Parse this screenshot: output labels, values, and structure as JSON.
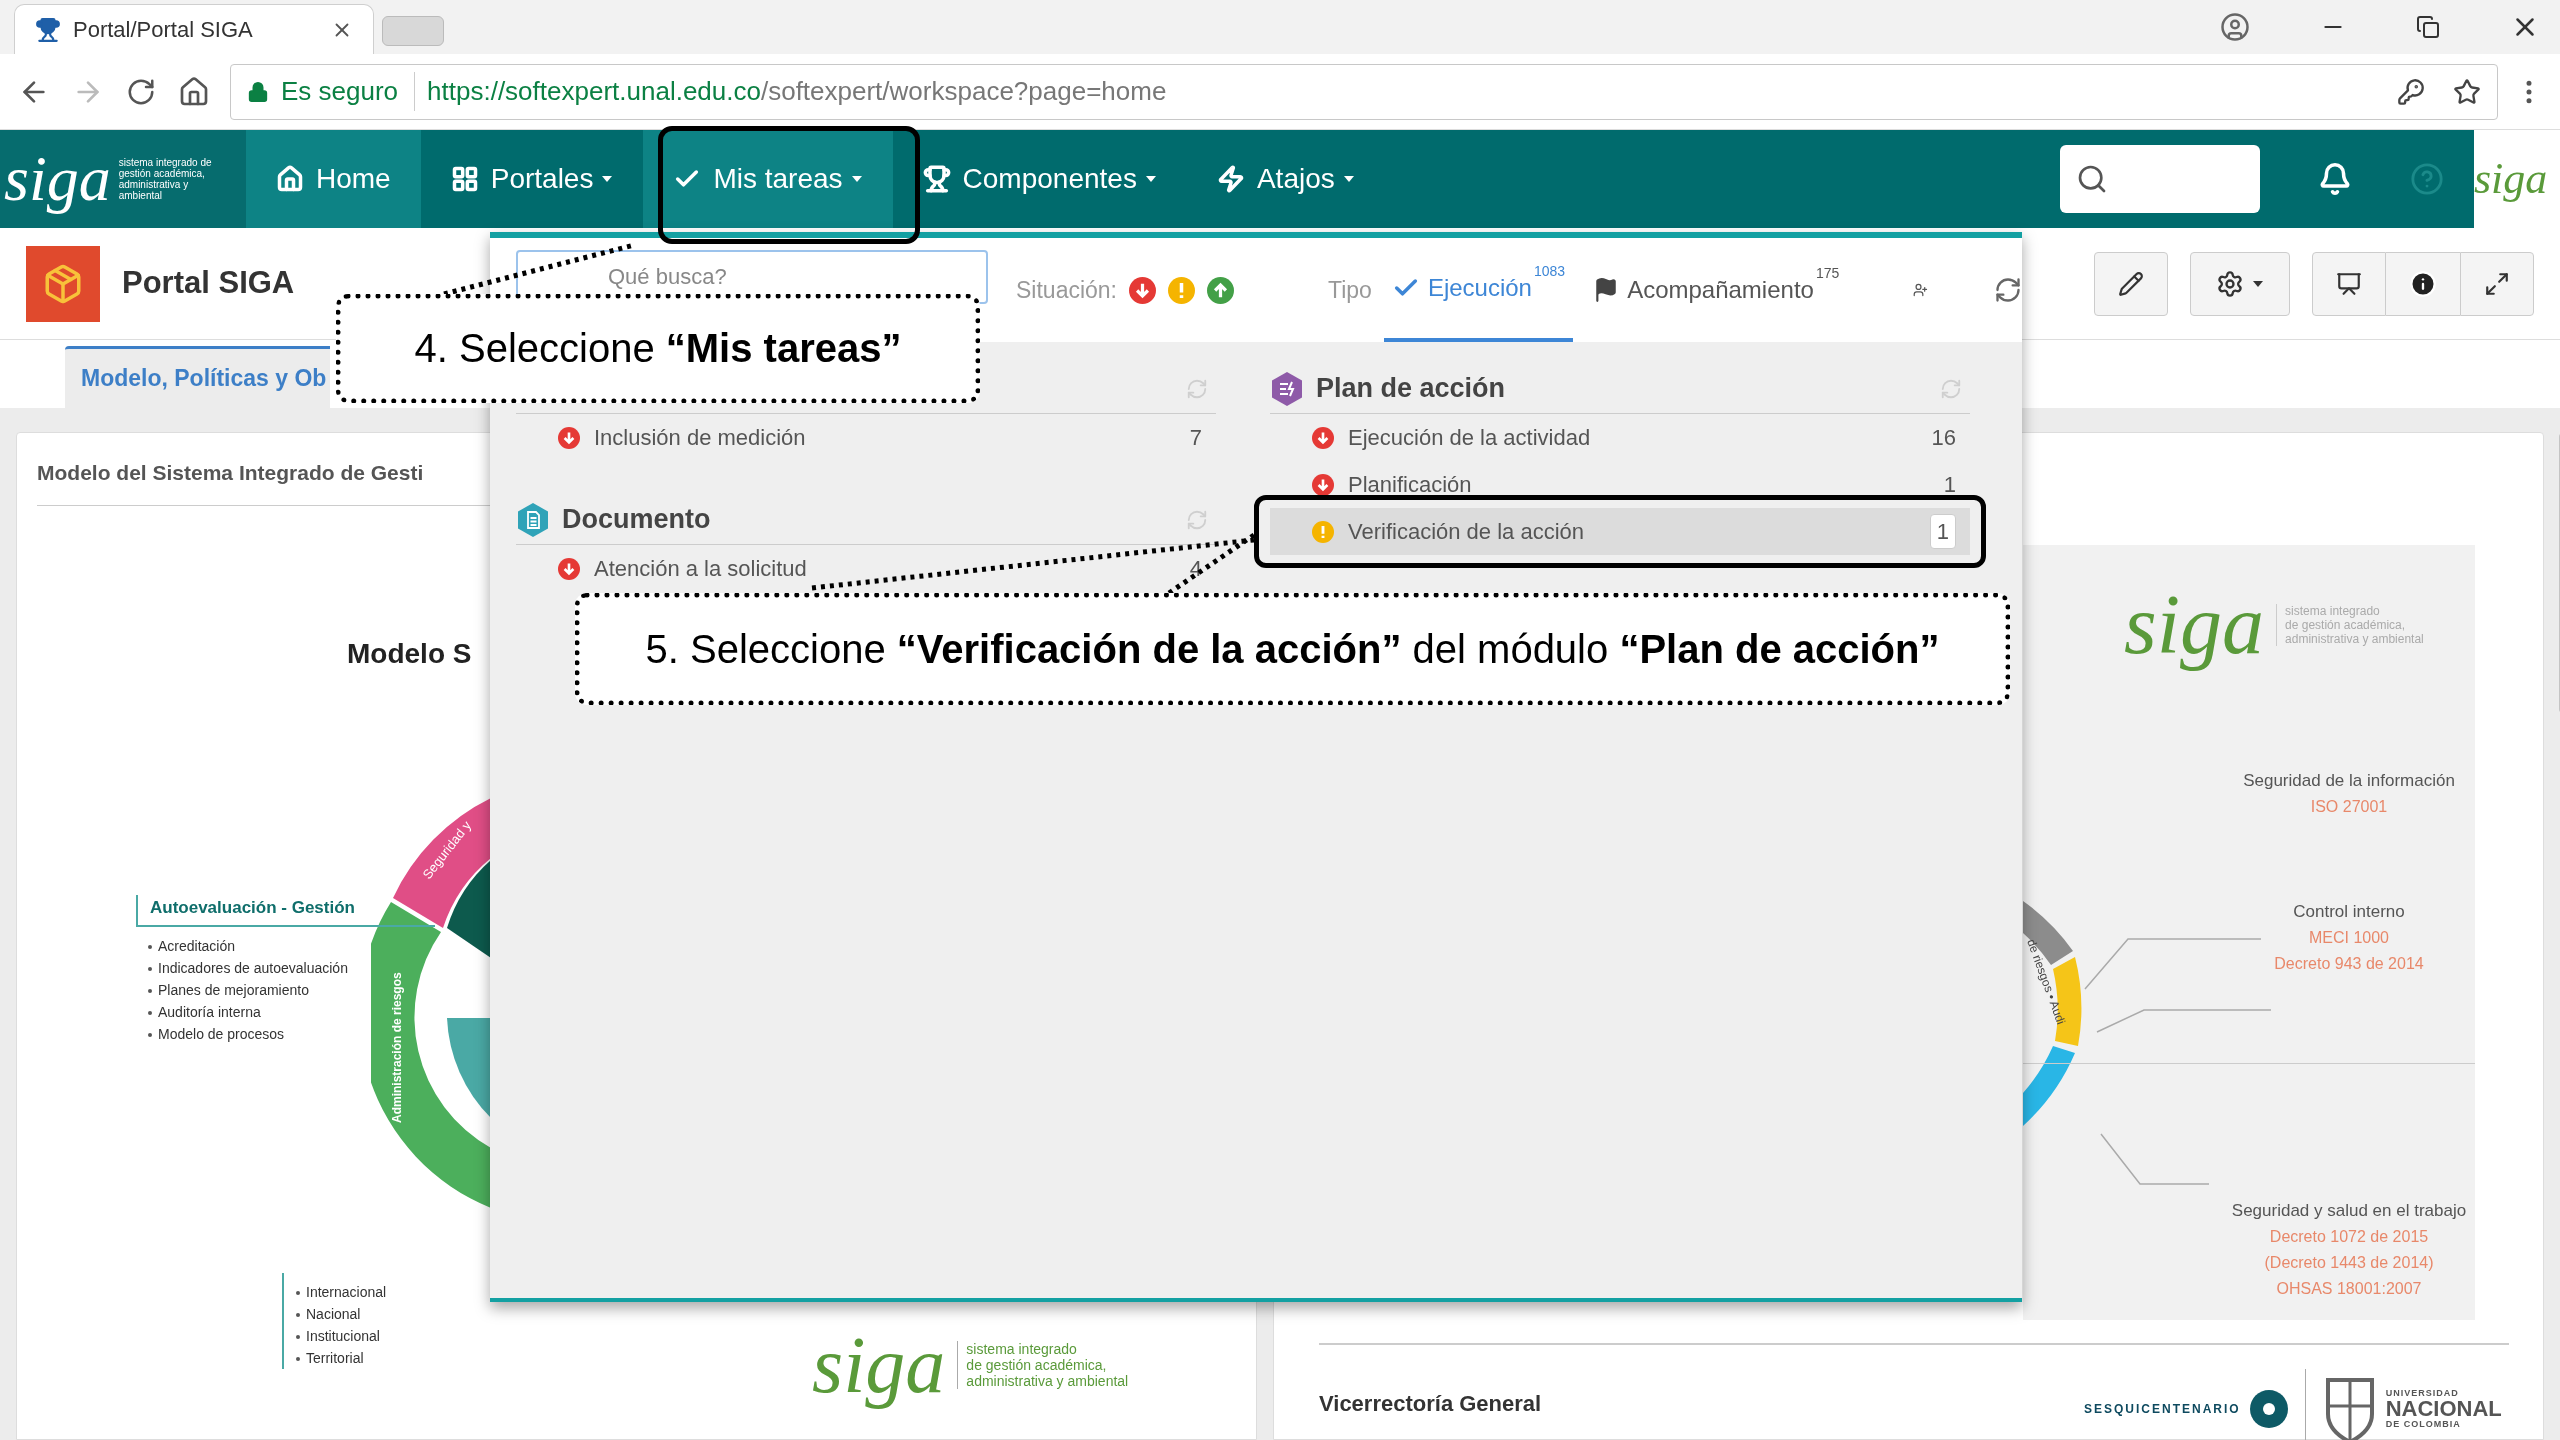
{
  "browser": {
    "tab_title": "Portal/Portal SIGA",
    "secure_label": "Es seguro",
    "url_host": "https://softexpert.unal.edu.co",
    "url_path": "/softexpert/workspace?page=home"
  },
  "nav": {
    "logo": "siga",
    "logo_tagline": "sistema integrado de gestión académica, administrativa y ambiental",
    "corner_logo": "siga",
    "items": [
      {
        "label": "Home",
        "kind": "home",
        "caret": false,
        "active": true
      },
      {
        "label": "Portales",
        "kind": "portals",
        "caret": true,
        "active": false
      },
      {
        "label": "Mis tareas",
        "kind": "tasks",
        "caret": true,
        "active": true
      },
      {
        "label": "Componentes",
        "kind": "components",
        "caret": true,
        "active": false
      },
      {
        "label": "Atajos",
        "kind": "shortcuts",
        "caret": true,
        "active": false
      }
    ]
  },
  "portal": {
    "title": "Portal SIGA"
  },
  "content_tabs": [
    {
      "label": "Modelo, Políticas y Ob",
      "selected": true
    }
  ],
  "left_panel": {
    "title": "Modelo del Sistema Integrado de Gesti",
    "diagram_heading": "Modelo S",
    "ring_labels": [
      "Seguridad y",
      "Administración de riesgos"
    ],
    "block": {
      "title": "Autoevaluación - Gestión",
      "items": [
        "Acreditación",
        "Indicadores de autoevaluación",
        "Planes de mejoramiento",
        "Auditoría interna",
        "Modelo de procesos"
      ]
    },
    "levels": [
      "Internacional",
      "Nacional",
      "Institucional",
      "Territorial"
    ],
    "logo": "siga",
    "logo_tagline": [
      "sistema integrado",
      "de gestión académica,",
      "administrativa y ambiental"
    ]
  },
  "right_panel": {
    "logo": "siga",
    "logo_tagline": [
      "sistema integrado",
      "de gestión académica,",
      "administrativa y ambiental"
    ],
    "ring_label": "de riesgos • Audi",
    "sections": [
      {
        "title": "Seguridad de la información",
        "lines": [
          "ISO 27001"
        ]
      },
      {
        "title": "Control interno",
        "lines": [
          "MECI 1000",
          "Decreto 943 de 2014"
        ]
      },
      {
        "title": "Seguridad y salud en el trabajo",
        "lines": [
          "Decreto 1072 de 2015",
          "(Decreto 1443 de 2014)",
          "OHSAS 18001:2007"
        ]
      }
    ],
    "footer": "Vicerrectoría General",
    "badge": "SESQUICENTENARIO",
    "university": [
      "UNIVERSIDAD",
      "NACIONAL",
      "DE COLOMBIA"
    ]
  },
  "tasks_menu": {
    "search": {
      "placeholder": "Qué busca?"
    },
    "situation_label": "Situación:",
    "situation_filters": [
      {
        "kind": "late"
      },
      {
        "kind": "warning"
      },
      {
        "kind": "on_time"
      }
    ],
    "type_label": "Tipo",
    "type_tabs": [
      {
        "label": "Ejecución",
        "count": "1083",
        "kind": "execution",
        "selected": true
      },
      {
        "label": "Acompañamiento",
        "count": "175",
        "kind": "follow_up",
        "selected": false
      }
    ],
    "columns": [
      {
        "groups": [
          {
            "items": [
              {
                "label": "Inclusión de medición",
                "count": "7",
                "kind": "late",
                "selected": false
              }
            ]
          },
          {
            "title": "Documento",
            "kind": "document",
            "items": [
              {
                "label": "Atención a la solicitud",
                "count": "4",
                "kind": "late",
                "selected": false
              }
            ]
          }
        ]
      },
      {
        "groups": [
          {
            "title": "Plan de acción",
            "kind": "plan",
            "items": [
              {
                "label": "Ejecución de la actividad",
                "count": "16",
                "kind": "late",
                "selected": false
              },
              {
                "label": "Planificación",
                "count": "1",
                "kind": "late",
                "selected": false
              },
              {
                "label": "Verificación de la acción",
                "count": "1",
                "kind": "warning",
                "selected": true
              }
            ]
          }
        ]
      }
    ]
  },
  "callouts": [
    "4. Seleccione **“Mis tareas”**",
    "5. Seleccione **“Verificación de la acción”** del módulo **“Plan de acción”**"
  ]
}
